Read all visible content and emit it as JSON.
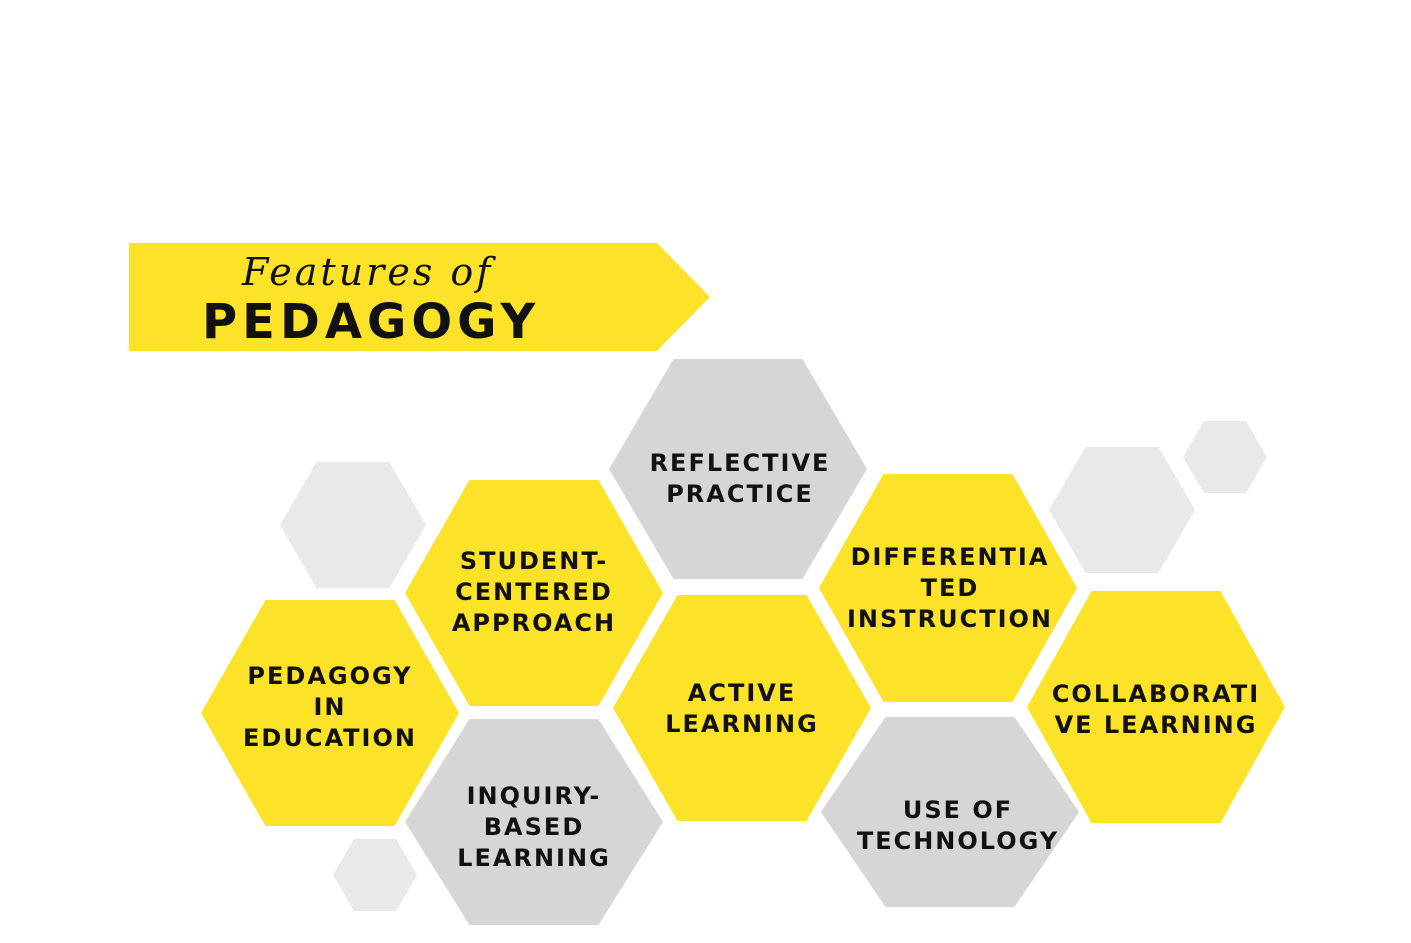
{
  "colors": {
    "yellow": "#fce32a",
    "gray_label": "#d6d6d6",
    "gray_deco": "#e9e9e9",
    "text": "#111111"
  },
  "banner": {
    "subtitle": "Features of",
    "title": "PEDAGOGY"
  },
  "hexagons": [
    {
      "id": "pedagogy-in-education",
      "color": "yellow",
      "lines": [
        "PEDAGOGY",
        "IN",
        "EDUCATION"
      ]
    },
    {
      "id": "student-centered-approach",
      "color": "yellow",
      "lines": [
        "STUDENT-",
        "CENTERED",
        "APPROACH"
      ]
    },
    {
      "id": "inquiry-based-learning",
      "color": "gray",
      "lines": [
        "INQUIRY-",
        "BASED",
        "LEARNING"
      ]
    },
    {
      "id": "reflective-practice",
      "color": "gray",
      "lines": [
        "REFLECTIVE",
        "PRACTICE"
      ]
    },
    {
      "id": "active-learning",
      "color": "yellow",
      "lines": [
        "ACTIVE",
        "LEARNING"
      ]
    },
    {
      "id": "differentiated-instruction",
      "color": "yellow",
      "lines": [
        "DIFFERENTIA",
        "TED",
        "INSTRUCTION"
      ]
    },
    {
      "id": "use-of-technology",
      "color": "gray",
      "lines": [
        "USE OF",
        "TECHNOLOGY"
      ]
    },
    {
      "id": "collaborative-learning",
      "color": "yellow",
      "lines": [
        "COLLABORATI",
        "VE LEARNING"
      ]
    }
  ]
}
